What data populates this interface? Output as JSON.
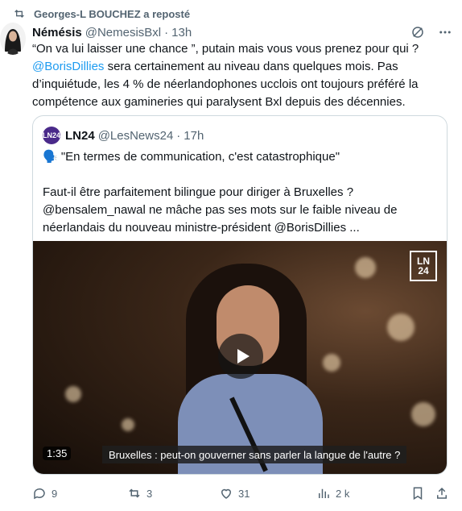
{
  "repost": {
    "text": "Georges-L BOUCHEZ a reposté"
  },
  "tweet": {
    "name": "Némésis",
    "handle": "@NemesisBxl",
    "separator": "·",
    "time": "13h",
    "text_part1": "“On va lui laisser une chance ”, putain mais vous vous prenez pour qui ?",
    "mention": "@BorisDillies",
    "text_part2": " sera certainement au niveau dans quelques mois. Pas d’inquiétude, les 4 % de néerlandophones ucclois ont toujours préféré la compétence aux gamineries qui paralysent Bxl depuis des décennies."
  },
  "quote": {
    "avatar_label": "LN24",
    "name": "LN24",
    "handle": "@LesNews24",
    "separator": "·",
    "time": "17h",
    "line1": "🗣️ \"En termes de communication, c'est catastrophique\"",
    "line2": "Faut-il être parfaitement bilingue pour diriger à Bruxelles ?",
    "line3": "@bensalem_nawal ne mâche pas ses mots sur le faible niveau de néerlandais du nouveau ministre-président @BorisDillies ...",
    "video": {
      "channel_logo": "LN 24",
      "duration": "1:35",
      "ticker": "Bruxelles : peut-on gouverner sans parler la langue de l'autre ?"
    }
  },
  "actions": {
    "replies": "9",
    "reposts": "3",
    "likes": "31",
    "views": "2 k"
  },
  "colors": {
    "accent": "#1d9bf0",
    "muted": "#536471",
    "text": "#0f1419"
  }
}
